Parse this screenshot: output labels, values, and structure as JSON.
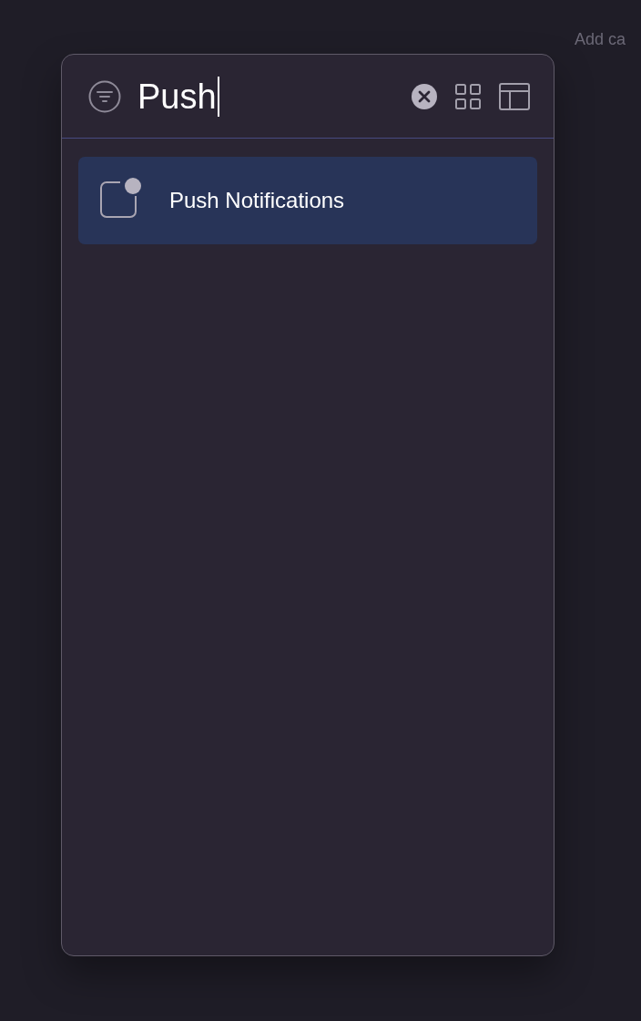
{
  "background_label": "Add ca",
  "search": {
    "value": "Push"
  },
  "results": [
    {
      "label": "Push Notifications",
      "selected": true
    }
  ]
}
